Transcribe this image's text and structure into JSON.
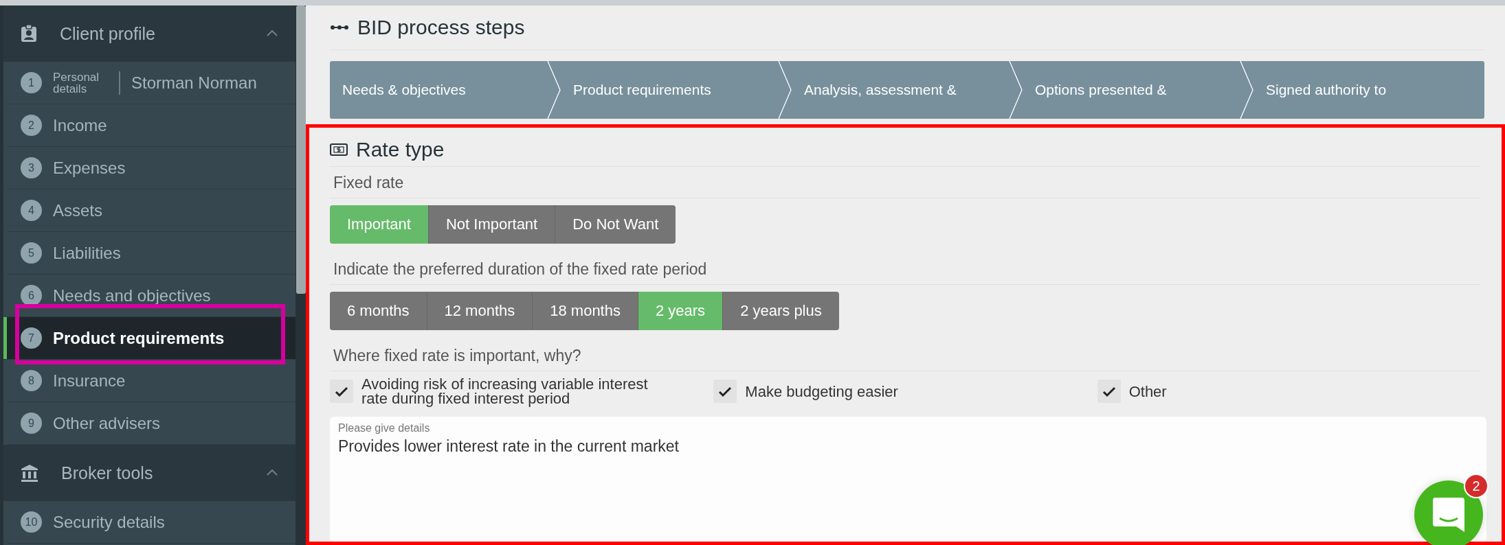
{
  "sidebar": {
    "sections": [
      {
        "title": "Client profile",
        "expanded": true,
        "items": [
          {
            "number": "1",
            "label": "Personal details",
            "value": "Storman Norman",
            "selected": false
          },
          {
            "number": "2",
            "label": "Income",
            "selected": false
          },
          {
            "number": "3",
            "label": "Expenses",
            "selected": false
          },
          {
            "number": "4",
            "label": "Assets",
            "selected": false
          },
          {
            "number": "5",
            "label": "Liabilities",
            "selected": false
          },
          {
            "number": "6",
            "label": "Needs and objectives",
            "selected": false
          },
          {
            "number": "7",
            "label": "Product requirements",
            "selected": true
          },
          {
            "number": "8",
            "label": "Insurance",
            "selected": false
          },
          {
            "number": "9",
            "label": "Other advisers",
            "selected": false
          }
        ]
      },
      {
        "title": "Broker tools",
        "expanded": true,
        "items": [
          {
            "number": "10",
            "label": "Security details",
            "selected": false
          }
        ]
      }
    ]
  },
  "bid_process": {
    "title": "BID process steps",
    "steps": [
      "Needs & objectives",
      "Product requirements",
      "Analysis, assessment &",
      "Options presented &",
      "Signed authority to"
    ]
  },
  "rate_type": {
    "title": "Rate type",
    "fixed_rate": {
      "label": "Fixed rate",
      "options": [
        {
          "label": "Important",
          "selected": true
        },
        {
          "label": "Not Important",
          "selected": false
        },
        {
          "label": "Do Not Want",
          "selected": false
        }
      ]
    },
    "duration": {
      "label": "Indicate the preferred duration of the fixed rate period",
      "options": [
        {
          "label": "6 months",
          "selected": false
        },
        {
          "label": "12 months",
          "selected": false
        },
        {
          "label": "18 months",
          "selected": false
        },
        {
          "label": "2 years",
          "selected": true
        },
        {
          "label": "2 years plus",
          "selected": false
        }
      ]
    },
    "reasons": {
      "label": "Where fixed rate is important, why?",
      "options": [
        {
          "label": "Avoiding risk of increasing variable interest rate during fixed interest period",
          "checked": true
        },
        {
          "label": "Make budgeting easier",
          "checked": true
        },
        {
          "label": "Other",
          "checked": true
        }
      ]
    },
    "details": {
      "label": "Please give details",
      "value": "Provides lower interest rate in the current market"
    }
  },
  "chat": {
    "badge": "2"
  },
  "highlights": [
    {
      "kind": "item",
      "color": "#d6009f"
    },
    {
      "kind": "panel",
      "color": "#ff0000"
    }
  ]
}
